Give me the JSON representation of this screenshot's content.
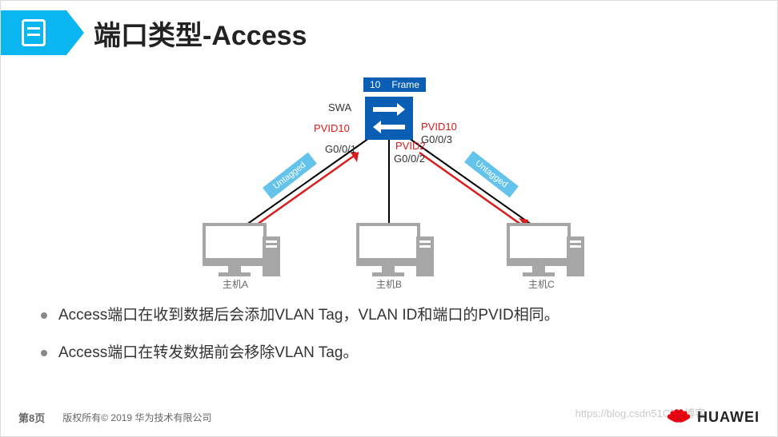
{
  "header": {
    "title": "端口类型-Access"
  },
  "diagram": {
    "frame": {
      "vlan": "10",
      "label": "Frame"
    },
    "switch_name": "SWA",
    "ports": {
      "left": {
        "pvid": "PVID10",
        "if": "G0/0/1",
        "tag": "Untagged"
      },
      "middle": {
        "pvid": "PVID2",
        "if": "G0/0/2"
      },
      "right": {
        "pvid": "PVID10",
        "if": "G0/0/3",
        "tag": "Untagged"
      }
    },
    "hosts": {
      "a": "主机A",
      "b": "主机B",
      "c": "主机C"
    }
  },
  "bullets": [
    "Access端口在收到数据后会添加VLAN Tag，VLAN ID和端口的PVID相同。",
    "Access端口在转发数据前会移除VLAN Tag。"
  ],
  "footer": {
    "page": "第8页",
    "copyright": "版权所有© 2019 华为技术有限公司",
    "brand": "HUAWEI",
    "watermark": "https://blog.csdn51CTO博客"
  }
}
